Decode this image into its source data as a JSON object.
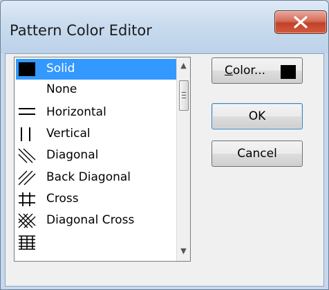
{
  "window": {
    "title": "Pattern Color Editor"
  },
  "patterns": {
    "items": [
      {
        "label": "Solid",
        "icon": "solid-pattern-icon",
        "selected": true
      },
      {
        "label": "None",
        "icon": "none-pattern-icon",
        "selected": false
      },
      {
        "label": "Horizontal",
        "icon": "horizontal-pattern-icon",
        "selected": false
      },
      {
        "label": "Vertical",
        "icon": "vertical-pattern-icon",
        "selected": false
      },
      {
        "label": "Diagonal",
        "icon": "diagonal-pattern-icon",
        "selected": false
      },
      {
        "label": "Back Diagonal",
        "icon": "back-diagonal-pattern-icon",
        "selected": false
      },
      {
        "label": "Cross",
        "icon": "cross-pattern-icon",
        "selected": false
      },
      {
        "label": "Diagonal Cross",
        "icon": "diagonal-cross-pattern-icon",
        "selected": false
      },
      {
        "label": "",
        "icon": "dense-pattern-icon",
        "selected": false
      }
    ]
  },
  "buttons": {
    "color": {
      "mnemonic": "C",
      "rest": "olor...",
      "swatch_color": "#000000"
    },
    "ok": "OK",
    "cancel": "Cancel"
  },
  "colors": {
    "selection": "#3399ff",
    "close_button": "#c0412a"
  }
}
